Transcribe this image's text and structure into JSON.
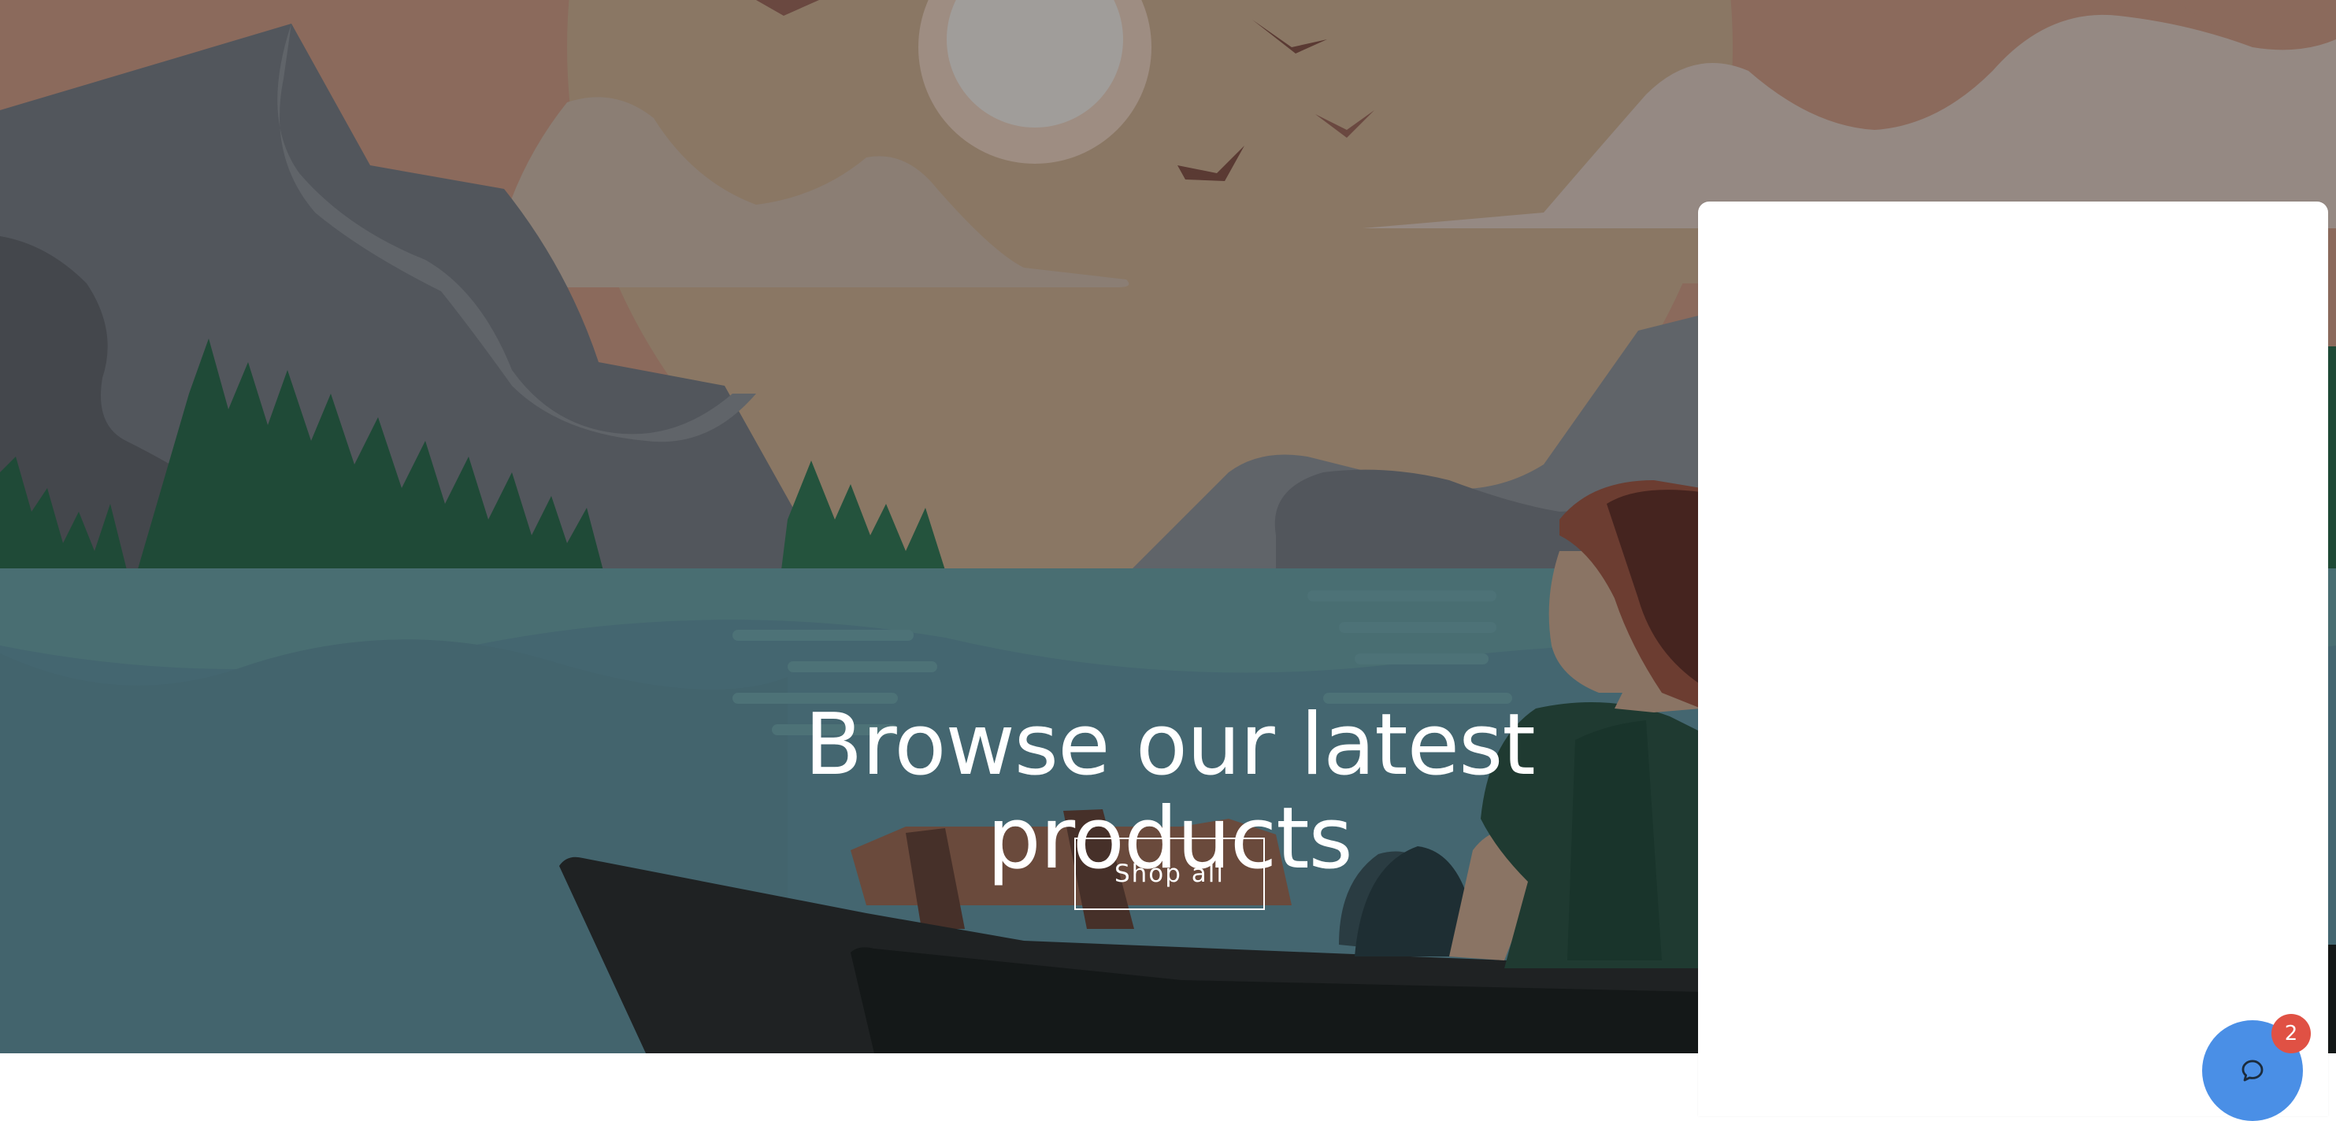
{
  "hero": {
    "title": "Browse our latest products",
    "button_label": "Shop all",
    "background_icon": "lake-landscape-illustration"
  },
  "chat": {
    "icon": "chat-bubble-icon",
    "unread_count": "2",
    "accent_color": "#4a8fe6",
    "badge_color": "#e05144"
  },
  "colors": {
    "sky": "#8b6a5c",
    "water": "#446670",
    "mountain": "#52565c",
    "trees": "#1f4a37"
  }
}
